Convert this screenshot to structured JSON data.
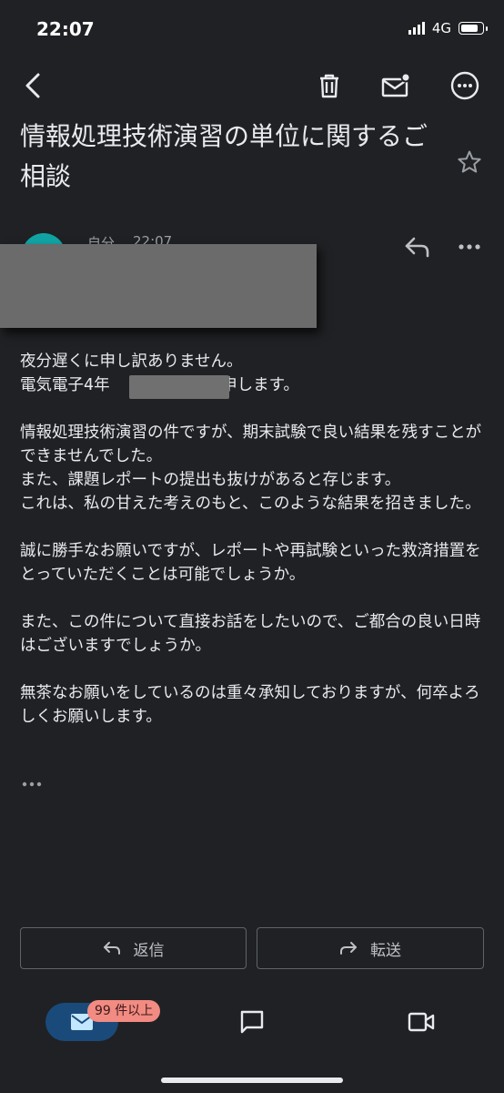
{
  "status_bar": {
    "time": "22:07",
    "network": "4G"
  },
  "toolbar": {
    "back_icon": "back-arrow-icon",
    "delete_icon": "trash-icon",
    "unread_icon": "mark-unread-icon",
    "more_icon": "more-vert-icon"
  },
  "email": {
    "subject": "情報処理技術演習の単位に関するご相談",
    "sender": "自分",
    "time": "22:07",
    "body": [
      "夜分遅くに申し訳ありません。\n電気電子4年　　　　　　と申します。",
      "情報処理技術演習の件ですが、期末試験で良い結果を残すことができませんでした。\nまた、課題レポートの提出も抜けがあると存じます。\nこれは、私の甘えた考えのもと、このような結果を招きました。",
      "誠に勝手なお願いですが、レポートや再試験といった救済措置をとっていただくことは可能でしょうか。",
      "また、この件について直接お話をしたいので、ご都合の良い日時はございますでしょうか。",
      "無茶なお願いをしているのは重々承知しておりますが、何卒よろしくお願いします。"
    ]
  },
  "actions": {
    "reply": "返信",
    "forward": "転送"
  },
  "bottom_nav": {
    "mail_badge": "99 件以上"
  },
  "colors": {
    "background": "#202124",
    "avatar": "#12a4a4",
    "badge": "#f28b82",
    "nav_active": "#1a4a7a"
  }
}
